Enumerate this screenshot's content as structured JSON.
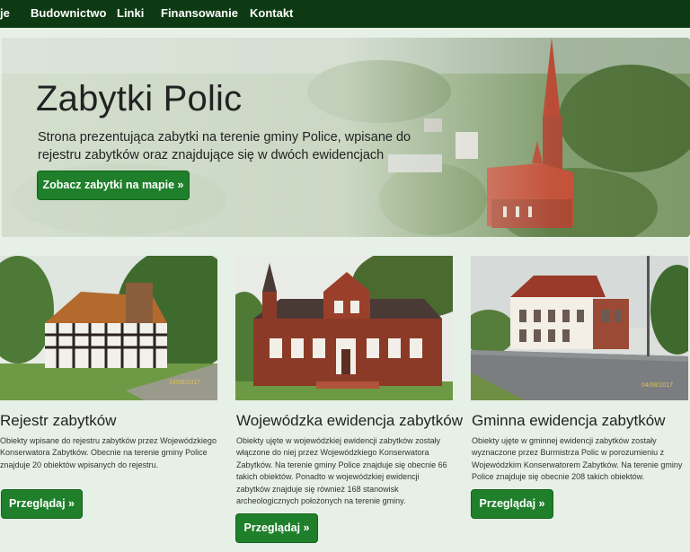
{
  "nav": {
    "items": [
      {
        "label": "je"
      },
      {
        "label": "Budownictwo"
      },
      {
        "label": "Linki"
      },
      {
        "label": "Finansowanie"
      },
      {
        "label": "Kontakt"
      }
    ]
  },
  "hero": {
    "title": "Zabytki Polic",
    "description": "Strona prezentująca zabytki na terenie gminy Police, wpisane do rejestru zabytków oraz znajdujące się w dwóch ewidencjach",
    "button_label": "Zobacz zabytki na mapie »"
  },
  "cards": [
    {
      "title": "Rejestr zabytków",
      "text": "Obiekty wpisane do rejestru zabytków przez Wojewódzkiego Konserwatora Zabytków. Obecnie na terenie gminy Police znajduje 20 obiektów wpisanych do rejestru.",
      "button_label": "Przeglądaj »",
      "photo_date": "14/08/2017"
    },
    {
      "title": "Wojewódzka ewidencja zabytków",
      "text": "Obiekty ujęte w wojewódzkiej ewidencji zabytków zostały włączone do niej przez Wojewódzkiego Konserwatora Zabytków. Na terenie gminy Police znajduje się obecnie 66 takich obiektów. Ponadto w wojewódzkiej ewidencji zabytków znajduje się również 168 stanowisk archeologicznych położonych na terenie gminy.",
      "button_label": "Przeglądaj »"
    },
    {
      "title": "Gminna ewidencja zabytków",
      "text": "Obiekty ujęte w gminnej ewidencji zabytków zostały wyznaczone przez Burmistrza Polic w porozumieniu z Wojewódzkim Konserwatorem Zabytków. Na terenie gminy Police znajduje się obecnie 208 takich obiektów.",
      "button_label": "Przeglądaj »",
      "photo_date": "04/08/2017"
    }
  ]
}
